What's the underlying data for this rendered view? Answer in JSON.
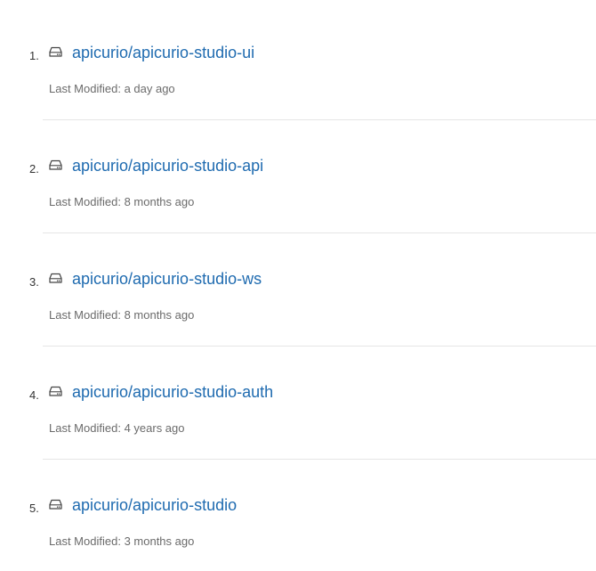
{
  "repositories": [
    {
      "index": "1.",
      "name": "apicurio/apicurio-studio-ui",
      "modified_label": "Last Modified:",
      "modified": "a day ago",
      "icon": "repo-drive-icon"
    },
    {
      "index": "2.",
      "name": "apicurio/apicurio-studio-api",
      "modified_label": "Last Modified:",
      "modified": "8 months ago",
      "icon": "repo-drive-icon"
    },
    {
      "index": "3.",
      "name": "apicurio/apicurio-studio-ws",
      "modified_label": "Last Modified:",
      "modified": "8 months ago",
      "icon": "repo-drive-icon"
    },
    {
      "index": "4.",
      "name": "apicurio/apicurio-studio-auth",
      "modified_label": "Last Modified:",
      "modified": "4 years ago",
      "icon": "repo-drive-icon"
    },
    {
      "index": "5.",
      "name": "apicurio/apicurio-studio",
      "modified_label": "Last Modified:",
      "modified": "3 months ago",
      "icon": "repo-drive-icon"
    }
  ],
  "colors": {
    "link": "#1f6bb0",
    "meta_text": "#6b6b6b",
    "divider": "#e6e6e6"
  }
}
